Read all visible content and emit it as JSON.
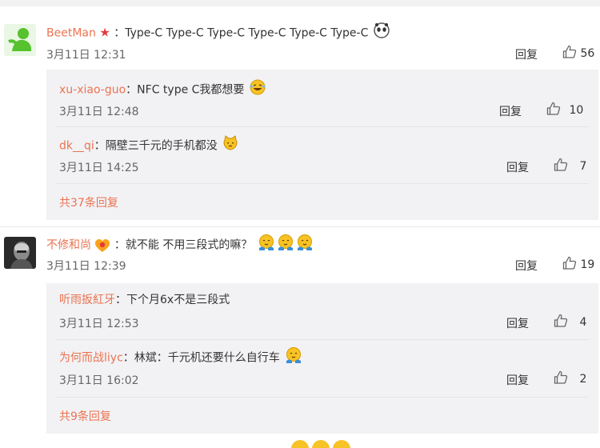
{
  "comments": [
    {
      "user": "BeetMan",
      "text": "：Type-C Type-C Type-C Type-C Type-C Type-C",
      "time": "3月11日 12:31",
      "reply_label": "回复",
      "likes": "56",
      "replies": [
        {
          "user": "xu-xiao-guo",
          "text": "：NFC type C我都想要",
          "time": "3月11日 12:48",
          "reply_label": "回复",
          "likes": "10"
        },
        {
          "user": "dk__qi",
          "text": "：隔壁三千元的手机都没",
          "time": "3月11日 14:25",
          "reply_label": "回复",
          "likes": "7"
        }
      ],
      "more": "共37条回复"
    },
    {
      "user": "不修和尚",
      "text": "：就不能 不用三段式的嘛？",
      "time": "3月11日 12:39",
      "reply_label": "回复",
      "likes": "19",
      "replies": [
        {
          "user": "听雨扳紅牙",
          "text": "：下个月6x不是三段式",
          "time": "3月11日 12:53",
          "reply_label": "回复",
          "likes": "4"
        },
        {
          "user": "为何而战liyc",
          "text": "：林斌：千元机还要什么自行车",
          "time": "3月11日 16:02",
          "reply_label": "回复",
          "likes": "2"
        }
      ],
      "more": "共9条回复"
    }
  ],
  "colors": {
    "username": "#eb7350",
    "reply_bg": "#f2f2f5"
  }
}
